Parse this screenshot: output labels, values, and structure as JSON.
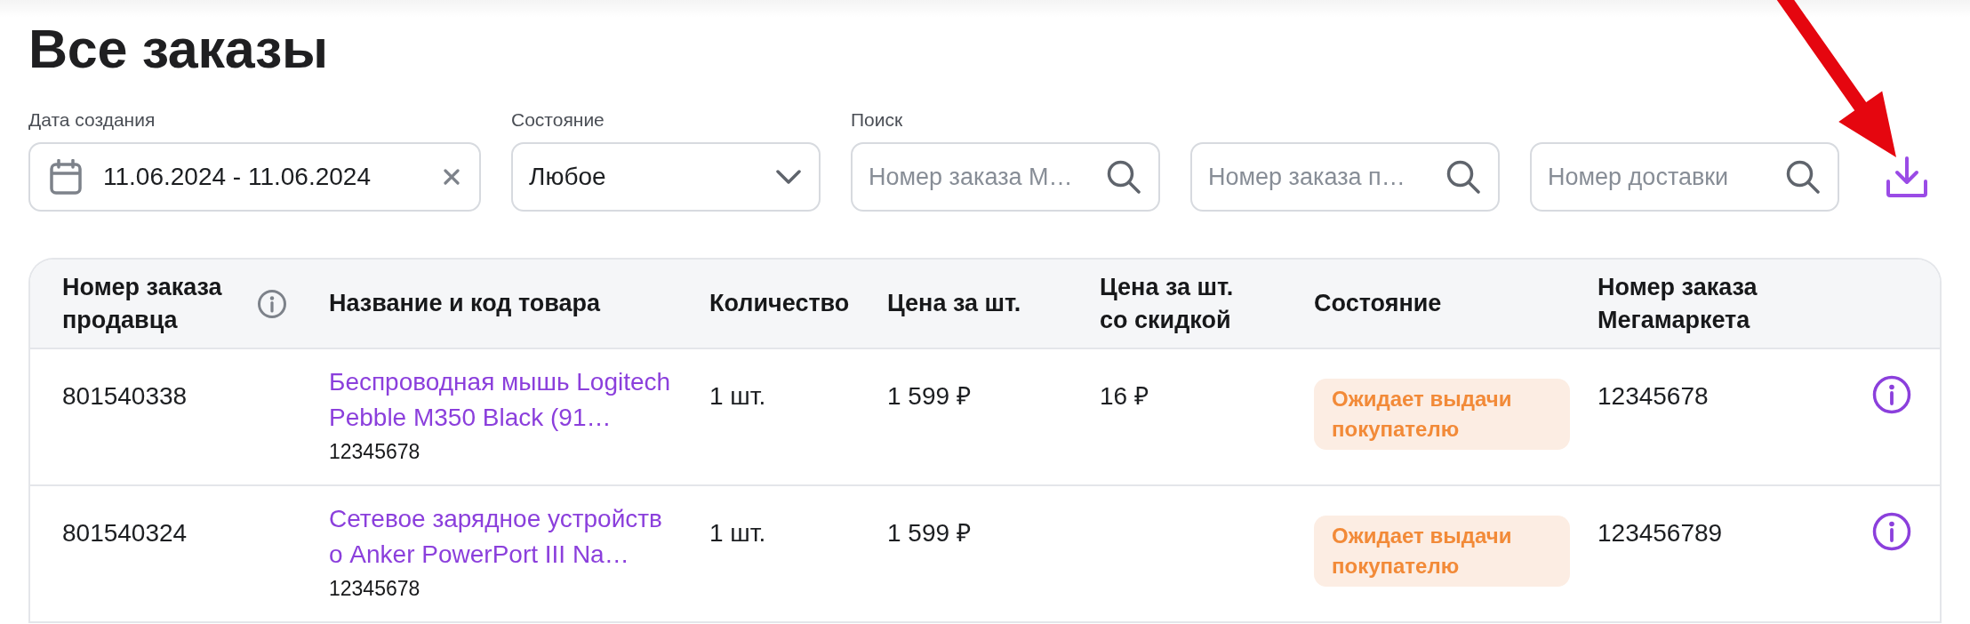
{
  "page": {
    "title": "Все заказы"
  },
  "filters": {
    "date": {
      "label": "Дата создания",
      "value": "11.06.2024 - 11.06.2024"
    },
    "status": {
      "label": "Состояние",
      "value": "Любое"
    },
    "search": {
      "label": "Поиск",
      "fields": [
        {
          "placeholder": "Номер заказа М…"
        },
        {
          "placeholder": "Номер заказа п…"
        },
        {
          "placeholder": "Номер доставки"
        }
      ]
    }
  },
  "table": {
    "columns": [
      {
        "label": "Номер заказа продавца",
        "info": true
      },
      {
        "label": "Название и код товара",
        "info": false
      },
      {
        "label": "Количество",
        "info": false
      },
      {
        "label": "Цена за шт.",
        "info": false
      },
      {
        "label": "Цена за шт. со скидкой",
        "info": false
      },
      {
        "label": "Состояние",
        "info": false
      },
      {
        "label": "Номер заказа Мегамаркета",
        "info": false
      }
    ],
    "rows": [
      {
        "seller_order": "801540338",
        "product_name": "Беспроводная мышь Logitech Pebble M350 Black (91…",
        "product_code": "12345678",
        "quantity": "1 шт.",
        "price": "1 599 ₽",
        "discount_price": "16 ₽",
        "status": "Ожидает выдачи покупателю",
        "marketplace_order": "12345678"
      },
      {
        "seller_order": "801540324",
        "product_name": "Сетевое зарядное устройство Anker PowerPort III Na…",
        "product_code": "12345678",
        "quantity": "1 шт.",
        "price": "1 599 ₽",
        "status": "Ожидает выдачи покупателю",
        "marketplace_order": "123456789"
      }
    ]
  }
}
